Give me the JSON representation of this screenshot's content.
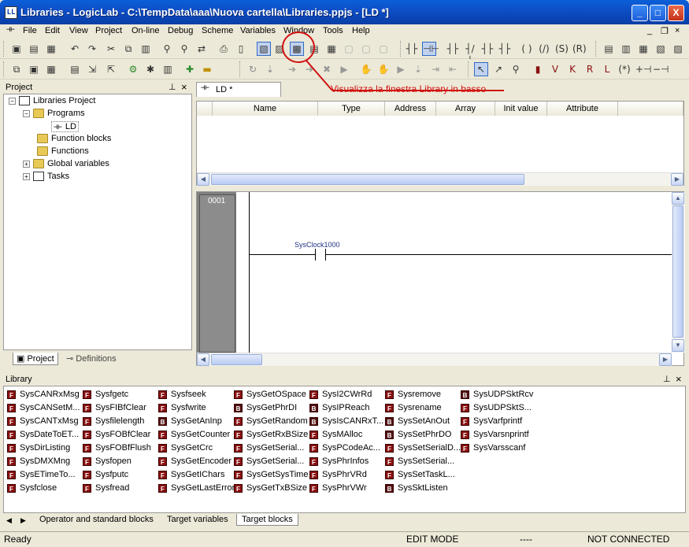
{
  "window": {
    "title": "Libraries - LogicLab - C:\\TempData\\aaa\\Nuova cartella\\Libraries.ppjs - [LD *]",
    "app_icon": "LL",
    "minimize": "_",
    "maximize": "□",
    "close": "X"
  },
  "menu": [
    "File",
    "Edit",
    "View",
    "Project",
    "On-line",
    "Debug",
    "Scheme",
    "Variables",
    "Window",
    "Tools",
    "Help"
  ],
  "annotation": {
    "text": "Visualizza la finestra Library in basso",
    "color": "#d01010"
  },
  "project": {
    "title": "Project",
    "root": "Libraries Project",
    "items": [
      "Programs",
      "LD",
      "Function blocks",
      "Functions",
      "Global variables",
      "Tasks"
    ],
    "tabs": [
      "Project",
      "Definitions"
    ]
  },
  "editor": {
    "tab": "LD *",
    "columns": [
      "Name",
      "Type",
      "Address",
      "Array",
      "Init value",
      "Attribute"
    ],
    "rung_number": "0001",
    "contact_label": "SysClock1000"
  },
  "library": {
    "title": "Library",
    "columns": [
      [
        "SysCANRxMsg",
        "SysCANSetM...",
        "SysCANTxMsg",
        "SysDateToET...",
        "SysDirListing",
        "SysDMXMng",
        "SysETimeTo...",
        "Sysfclose"
      ],
      [
        "Sysfgetc",
        "SysFIBfClear",
        "Sysfilelength",
        "SysFOBfClear",
        "SysFOBfFlush",
        "Sysfopen",
        "Sysfputc",
        "Sysfread"
      ],
      [
        "Sysfseek",
        "Sysfwrite",
        "SysGetAnInp",
        "SysGetCounter",
        "SysGetCrc",
        "SysGetEncoder",
        "SysGetIChars",
        "SysGetLastError"
      ],
      [
        "SysGetOSpace",
        "SysGetPhrDI",
        "SysGetRandom",
        "SysGetRxBSize",
        "SysGetSerial...",
        "SysGetSerial...",
        "SysGetSysTime",
        "SysGetTxBSize"
      ],
      [
        "SysI2CWrRd",
        "SysIPReach",
        "SysIsCANRxT...",
        "SysMAlloc",
        "SysPCodeAc...",
        "SysPhrInfos",
        "SysPhrVRd",
        "SysPhrVWr"
      ],
      [
        "Sysremove",
        "Sysrename",
        "SysSetAnOut",
        "SysSetPhrDO",
        "SysSetSerialD...",
        "SysSetSerial...",
        "SysSetTaskL...",
        "SysSktListen"
      ],
      [
        "SysUDPSktRcv",
        "SysUDPSktS...",
        "SysVarfprintf",
        "SysVarsnprintf",
        "SysVarsscanf"
      ]
    ],
    "tabs": [
      "Operator and standard blocks",
      "Target variables",
      "Target blocks"
    ]
  },
  "status": {
    "ready": "Ready",
    "mode": "EDIT MODE",
    "dashes": "----",
    "connection": "NOT CONNECTED"
  }
}
